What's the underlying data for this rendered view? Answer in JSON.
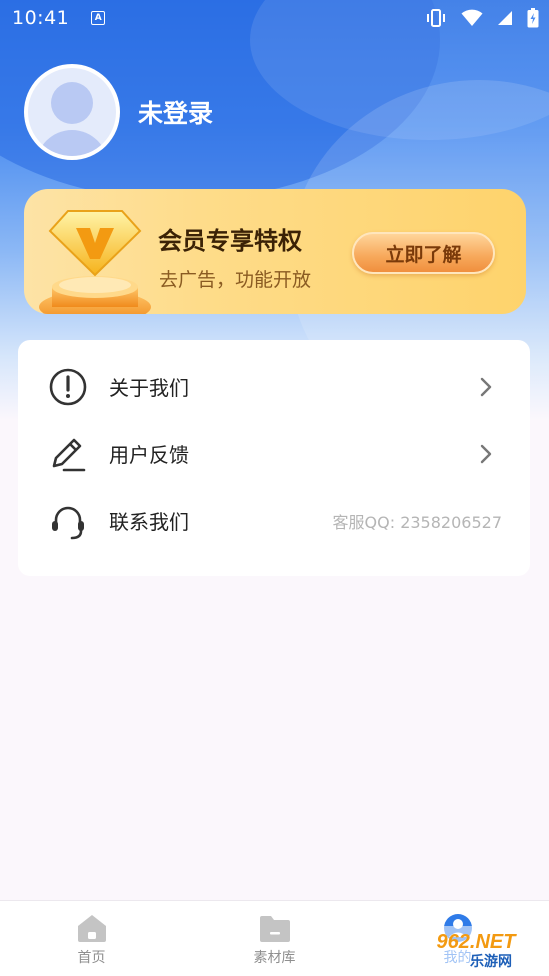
{
  "status_bar": {
    "time": "10:41",
    "notification_glyph": "A"
  },
  "profile": {
    "username": "未登录"
  },
  "vip_card": {
    "title": "会员专享特权",
    "subtitle": "去广告，功能开放",
    "button_label": "立即了解",
    "badge_letter": "V"
  },
  "menu": {
    "items": [
      {
        "icon": "info-circle-icon",
        "label": "关于我们",
        "has_chevron": true
      },
      {
        "icon": "pen-icon",
        "label": "用户反馈",
        "has_chevron": true
      },
      {
        "icon": "headset-icon",
        "label": "联系我们",
        "extra": "客服QQ: 2358206527"
      }
    ]
  },
  "bottom_nav": {
    "tabs": [
      {
        "icon": "home-icon",
        "label": "首页"
      },
      {
        "icon": "folder-icon",
        "label": "素材库"
      },
      {
        "icon": "user-icon",
        "label": "我的",
        "active": true
      }
    ]
  },
  "watermark": {
    "text_top": "962.NET",
    "text_bottom": "乐游网"
  },
  "colors": {
    "accent": "#2f7be8",
    "vip_gold": "#fed36c",
    "vip_button": "#f08f3e"
  }
}
